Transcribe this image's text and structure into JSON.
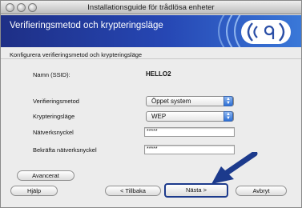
{
  "window": {
    "title": "Installationsguide för trådlösa enheter"
  },
  "header": {
    "title": "Verifieringsmetod och krypteringsläge",
    "logo_icon": "wireless-signal-icon",
    "brand_color": "#2647b4"
  },
  "subtitle": "Konfigurera verifieringsmetod och krypteringsläge",
  "ssid": {
    "label": "Namn (SSID):",
    "value": "HELLO2"
  },
  "form": {
    "auth": {
      "label": "Verifieringsmetod",
      "value": "Öppet system"
    },
    "encryption": {
      "label": "Krypteringsläge",
      "value": "WEP"
    },
    "network_key": {
      "label": "Nätverksnyckel",
      "value": "*****"
    },
    "confirm_key": {
      "label": "Bekräfta nätverksnyckel",
      "value": "*****"
    }
  },
  "buttons": {
    "advanced": "Avancerat",
    "help": "Hjälp",
    "back": "< Tillbaka",
    "next": "Nästa >",
    "cancel": "Avbryt"
  },
  "annotation": {
    "arrow_icon": "pointer-arrow-icon",
    "arrow_color": "#1c3a8c"
  }
}
